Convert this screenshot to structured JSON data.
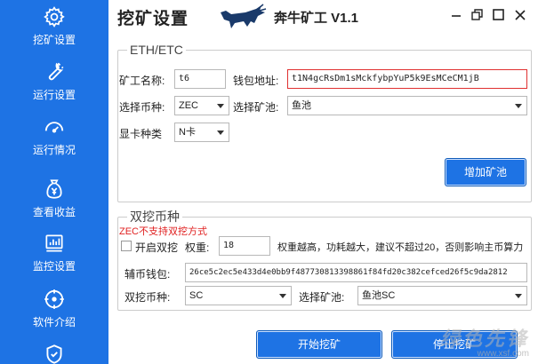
{
  "sidebar": {
    "items": [
      {
        "label": "挖矿设置",
        "icon": "gear-icon"
      },
      {
        "label": "运行设置",
        "icon": "wrench-icon"
      },
      {
        "label": "运行情况",
        "icon": "gauge-icon"
      },
      {
        "label": "查看收益",
        "icon": "money-bag-icon"
      },
      {
        "label": "监控设置",
        "icon": "monitor-chart-icon"
      },
      {
        "label": "软件介绍",
        "icon": "target-icon"
      },
      {
        "label": "",
        "icon": "shield-icon"
      }
    ]
  },
  "titlebar": {
    "title": "挖矿设置",
    "brand": "奔牛矿工 V1.1"
  },
  "eth_group": {
    "legend": "ETH/ETC",
    "worker_label": "矿工名称:",
    "worker_value": "t6",
    "wallet_label": "钱包地址:",
    "wallet_value": "t1N4gcRsDm1sMckfybpYuP5k9EsMCeCM1jB",
    "coin_label": "选择币种:",
    "coin_value": "ZEC",
    "pool_label": "选择矿池:",
    "pool_value": "鱼池",
    "gpu_label": "显卡种类",
    "gpu_value": "N卡",
    "add_pool_button": "增加矿池"
  },
  "dual_group": {
    "legend": "双挖币种",
    "warning": "ZEC不支持双挖方式",
    "enable_label": "开启双挖",
    "enable_checked": false,
    "weight_label": "权重:",
    "weight_value": "18",
    "weight_hint": "权重越高，功耗越大，建议不超过20，否则影响主币算力",
    "wallet_label": "辅币钱包:",
    "wallet_value": "26ce5c2ec5e433d4e0bb9f487730813398861f84fd20c382cefced26f5c9da2812",
    "coin_label": "双挖币种:",
    "coin_value": "SC",
    "pool_label": "选择矿池:",
    "pool_value": "鱼池SC"
  },
  "actions": {
    "start_button": "开始挖矿",
    "stop_button": "停止挖矿"
  },
  "watermark": {
    "text": "绿色先锋",
    "sub": "www.xsf.com"
  },
  "colors": {
    "sidebar": "#1e73e4",
    "button": "#1e73e4",
    "warning": "#e02020"
  }
}
